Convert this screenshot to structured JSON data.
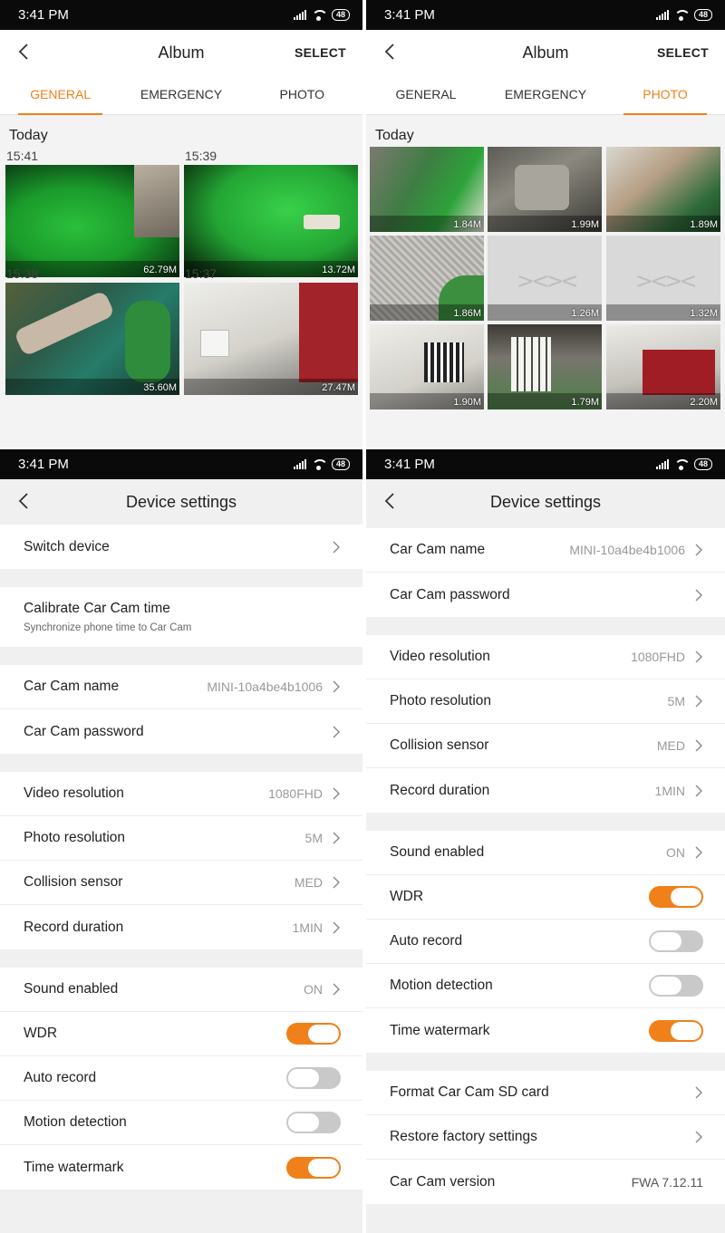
{
  "status": {
    "time": "3:41 PM",
    "battery": "48"
  },
  "album": {
    "title": "Album",
    "select_label": "SELECT",
    "tabs": [
      "GENERAL",
      "EMERGENCY",
      "PHOTO"
    ],
    "section": "Today",
    "general_items": [
      {
        "time": "15:41",
        "size": "62.79M"
      },
      {
        "time": "15:39",
        "size": "13.72M"
      },
      {
        "time": "15:38",
        "size": "35.60M"
      },
      {
        "time": "15:37",
        "size": "27.47M"
      }
    ],
    "photo_items": [
      {
        "size": "1.84M"
      },
      {
        "size": "1.99M"
      },
      {
        "size": "1.89M"
      },
      {
        "size": "1.86M"
      },
      {
        "size": "1.26M"
      },
      {
        "size": "1.32M"
      },
      {
        "size": "1.90M"
      },
      {
        "size": "1.79M"
      },
      {
        "size": "2.20M"
      }
    ]
  },
  "settings": {
    "title": "Device settings",
    "switch_device": "Switch device",
    "calibrate": "Calibrate Car Cam time",
    "calibrate_sub": "Synchronize phone time to Car Cam",
    "cam_name": "Car Cam name",
    "cam_name_value": "MINI-10a4be4b1006",
    "cam_password": "Car Cam password",
    "video_res": "Video resolution",
    "video_res_value": "1080FHD",
    "photo_res": "Photo resolution",
    "photo_res_value": "5M",
    "collision": "Collision sensor",
    "collision_value": "MED",
    "record_duration": "Record duration",
    "record_duration_value": "1MIN",
    "sound": "Sound enabled",
    "sound_value": "ON",
    "wdr": "WDR",
    "wdr_on": true,
    "auto_record": "Auto record",
    "auto_record_on": false,
    "motion": "Motion detection",
    "motion_on": false,
    "watermark": "Time watermark",
    "watermark_on": true,
    "format_sd": "Format Car Cam SD card",
    "restore": "Restore factory settings",
    "version": "Car Cam version",
    "version_value": "FWA 7.12.11"
  },
  "accent_color": "#f08019",
  "icons": [
    "back-arrow-icon",
    "chevron-right-icon",
    "signal-icon",
    "wifi-icon",
    "battery-icon",
    "placeholder-xx-icon"
  ]
}
